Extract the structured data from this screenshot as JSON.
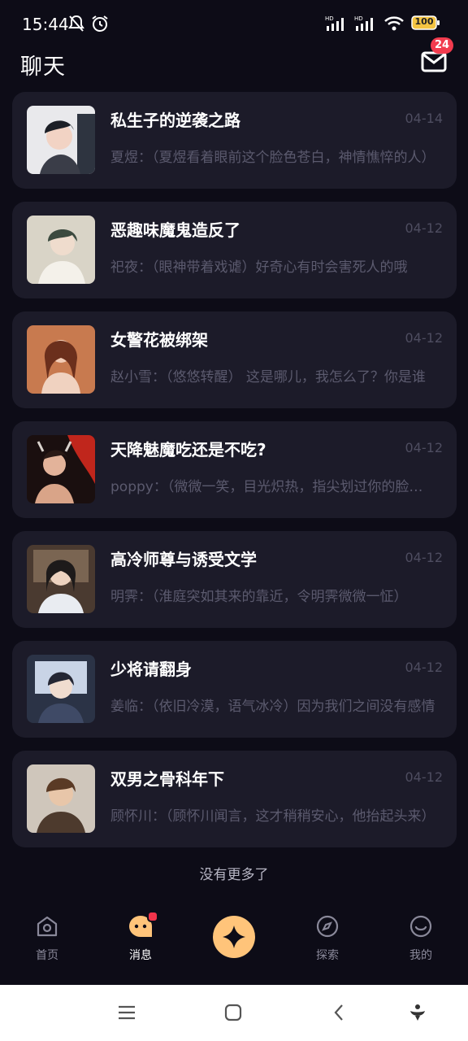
{
  "status_bar": {
    "time": "15:44",
    "battery": "100"
  },
  "header": {
    "title": "聊天",
    "mail_badge": "24"
  },
  "chats": [
    {
      "title": "私生子的逆袭之路",
      "date": "04-14",
      "preview": "夏煜：（夏煜看着眼前这个脸色苍白，神情憔悴的人）"
    },
    {
      "title": "恶趣味魔鬼造反了",
      "date": "04-12",
      "preview": "祀夜：（眼神带着戏谑）好奇心有时会害死人的哦"
    },
    {
      "title": "女警花被绑架",
      "date": "04-12",
      "preview": "赵小雪：（悠悠转醒） 这是哪儿，我怎么了？你是谁"
    },
    {
      "title": "天降魅魔吃还是不吃?",
      "date": "04-12",
      "preview": "poppy：（微微一笑，目光炽热，指尖划过你的脸庞）"
    },
    {
      "title": "高冷师尊与诱受文学",
      "date": "04-12",
      "preview": "明霁：（淮庭突如其来的靠近，令明霁微微一怔）"
    },
    {
      "title": "少将请翻身",
      "date": "04-12",
      "preview": "姜临：（依旧冷漠，语气冰冷）因为我们之间没有感情"
    },
    {
      "title": "双男之骨科年下",
      "date": "04-12",
      "preview": "顾怀川：（顾怀川闻言，这才稍稍安心，他抬起头来）"
    }
  ],
  "footer_text": "没有更多了",
  "tabs": [
    {
      "label": "首页",
      "icon": "home-icon"
    },
    {
      "label": "消息",
      "icon": "message-icon"
    },
    {
      "label": "",
      "icon": "sparkle-icon"
    },
    {
      "label": "探索",
      "icon": "compass-icon"
    },
    {
      "label": "我的",
      "icon": "smile-icon"
    }
  ],
  "colors": {
    "background": "#0d0c17",
    "card": "#1c1b29",
    "accent": "#ffc47a",
    "badge": "#f23b4e"
  }
}
